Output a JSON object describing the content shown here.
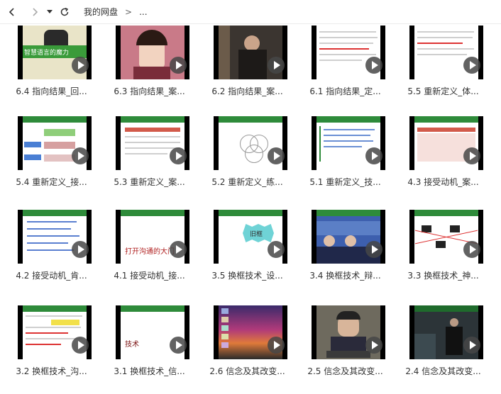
{
  "toolbar": {
    "back_icon": "chevron-left-icon",
    "forward_icon": "chevron-right-icon",
    "dropdown_icon": "caret-down-icon",
    "refresh_icon": "refresh-icon",
    "breadcrumb": [
      "我的网盘",
      "..."
    ],
    "separator": ">"
  },
  "files": [
    {
      "name": "6.4 指向结果_回..."
    },
    {
      "name": "6.3 指向结果_案..."
    },
    {
      "name": "6.2 指向结果_案..."
    },
    {
      "name": "6.1 指向结果_定..."
    },
    {
      "name": "5.5 重新定义_体..."
    },
    {
      "name": "5.4 重新定义_接..."
    },
    {
      "name": "5.3 重新定义_案..."
    },
    {
      "name": "5.2 重新定义_练..."
    },
    {
      "name": "5.1 重新定义_技..."
    },
    {
      "name": "4.3 接受动机_案..."
    },
    {
      "name": "4.2 接受动机_肯..."
    },
    {
      "name": "4.1 接受动机_接..."
    },
    {
      "name": "3.5 换框技术_设..."
    },
    {
      "name": "3.4 换框技术_辩..."
    },
    {
      "name": "3.3 换框技术_神..."
    },
    {
      "name": "3.2 换框技术_沟..."
    },
    {
      "name": "3.1 换框技术_信..."
    },
    {
      "name": "2.6 信念及其改变..."
    },
    {
      "name": "2.5 信念及其改变..."
    },
    {
      "name": "2.4 信念及其改变..."
    }
  ],
  "thumb_text": {
    "t0_title": "智慧语言的魔力",
    "t11_text": "打开沟通的大门",
    "t12_badge": "旧框",
    "t16_text": "技术"
  }
}
